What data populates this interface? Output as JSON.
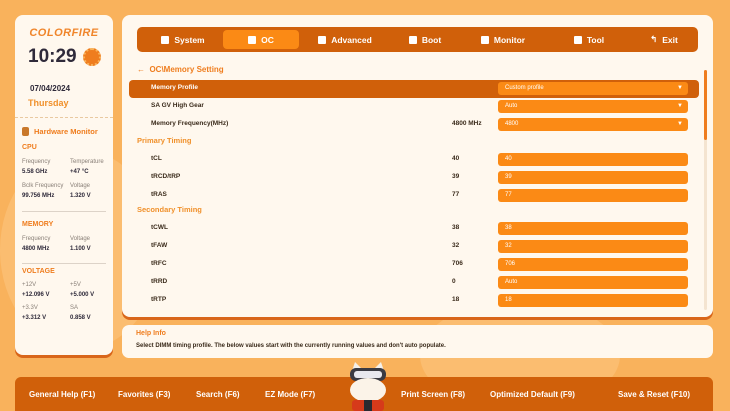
{
  "brand": "COLORFIRE",
  "clock": {
    "time": "10:29",
    "date": "07/04/2024",
    "day": "Thursday"
  },
  "hardware_monitor": {
    "title": "Hardware Monitor",
    "cpu": {
      "title": "CPU",
      "frequency_label": "Frequency",
      "frequency": "5.58 GHz",
      "temperature_label": "Temperature",
      "temperature": "+47 °C",
      "bclk_label": "Bclk Frequency",
      "bclk": "99.756 MHz",
      "voltage_label": "Voltage",
      "voltage": "1.320 V"
    },
    "memory": {
      "title": "MEMORY",
      "frequency_label": "Frequency",
      "frequency": "4800 MHz",
      "voltage_label": "Voltage",
      "voltage": "1.100 V"
    },
    "voltage": {
      "title": "VOLTAGE",
      "v12_label": "+12V",
      "v12": "+12.096 V",
      "v5_label": "+5V",
      "v5": "+5.000 V",
      "v33_label": "+3.3V",
      "v33": "+3.312 V",
      "sa_label": "SA",
      "sa": "0.858 V"
    }
  },
  "nav": {
    "tabs": [
      {
        "label": "System",
        "icon": "grid-icon"
      },
      {
        "label": "OC",
        "icon": "rocket-icon",
        "active": true
      },
      {
        "label": "Advanced",
        "icon": "castle-icon"
      },
      {
        "label": "Boot",
        "icon": "disk-icon"
      },
      {
        "label": "Monitor",
        "icon": "pulse-icon"
      },
      {
        "label": "Tool",
        "icon": "toolbox-icon"
      },
      {
        "label": "Exit",
        "icon": "exit-arrow-icon"
      }
    ]
  },
  "breadcrumb": "OC\\Memory Setting",
  "settings": {
    "memory_profile": {
      "label": "Memory Profile",
      "value": "Custom profile"
    },
    "sa_gv": {
      "label": "SA GV High Gear",
      "value": "Auto"
    },
    "mem_freq": {
      "label": "Memory Frequency(MHz)",
      "current": "4800 MHz",
      "value": "4800"
    },
    "primary_title": "Primary Timing",
    "primary": [
      {
        "label": "tCL",
        "current": "40",
        "value": "40"
      },
      {
        "label": "tRCD/tRP",
        "current": "39",
        "value": "39"
      },
      {
        "label": "tRAS",
        "current": "77",
        "value": "77"
      }
    ],
    "secondary_title": "Secondary Timing",
    "secondary": [
      {
        "label": "tCWL",
        "current": "38",
        "value": "38"
      },
      {
        "label": "tFAW",
        "current": "32",
        "value": "32"
      },
      {
        "label": "tRFC",
        "current": "706",
        "value": "706"
      },
      {
        "label": "tRRD",
        "current": "0",
        "value": "Auto"
      },
      {
        "label": "tRTP",
        "current": "18",
        "value": "18"
      }
    ]
  },
  "help": {
    "title": "Help Info",
    "text": "Select DIMM timing profile. The below values start with the currently running values and don't auto populate."
  },
  "footer": [
    "General Help (F1)",
    "Favorites (F3)",
    "Search (F6)",
    "EZ Mode (F7)",
    "Print Screen (F8)",
    "Optimized Default (F9)",
    "Save & Reset (F10)"
  ],
  "colors": {
    "accent": "#fb8a15",
    "dark_accent": "#d0600a",
    "panel": "#fff8ee"
  }
}
